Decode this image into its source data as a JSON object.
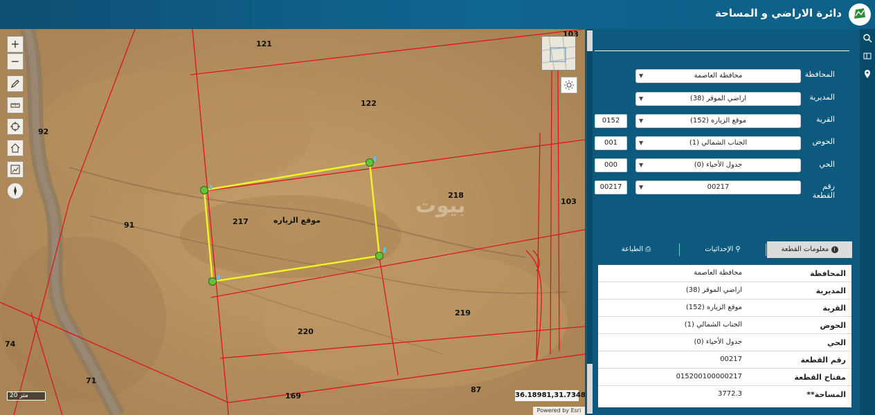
{
  "header": {
    "title": "دائرة الاراضي و المساحة"
  },
  "map": {
    "parcel_labels": [
      {
        "id": "121",
        "text": "121"
      },
      {
        "id": "103a",
        "text": "103"
      },
      {
        "id": "122",
        "text": "122"
      },
      {
        "id": "92",
        "text": "92"
      },
      {
        "id": "218",
        "text": "218"
      },
      {
        "id": "103b",
        "text": "103"
      },
      {
        "id": "217",
        "text": "217"
      },
      {
        "id": "91",
        "text": "91"
      },
      {
        "id": "219",
        "text": "219"
      },
      {
        "id": "220",
        "text": "220"
      },
      {
        "id": "74",
        "text": "74"
      },
      {
        "id": "71",
        "text": "71"
      },
      {
        "id": "87",
        "text": "87"
      },
      {
        "id": "169",
        "text": "169"
      }
    ],
    "site_label": "موقع الزياره",
    "watermark": "بيوت",
    "scale_text": "20 متر",
    "coordinates": "36.18981,31.73488",
    "attribution": "Powered by Esri",
    "zoom_in": "+",
    "zoom_out": "−"
  },
  "form": {
    "fields": [
      {
        "label": "المحافظة",
        "value": "محافظة العاصمة",
        "code": ""
      },
      {
        "label": "المديرية",
        "value": "اراضي الموقر (38)",
        "code": ""
      },
      {
        "label": "القرية",
        "value": "موقع الزياره (152)",
        "code": "0152"
      },
      {
        "label": "الحوض",
        "value": "الجناب الشمالي (1)",
        "code": "001"
      },
      {
        "label": "الحي",
        "value": "جدول الأحياء (0)",
        "code": "000"
      },
      {
        "label": "رقم القطعة",
        "value": "00217",
        "code": "00217"
      }
    ]
  },
  "tabs": {
    "parcel_info": "معلومات القطعة",
    "coordinates": "الإحداثيات",
    "print": "الطباعة"
  },
  "info": {
    "rows": [
      {
        "key": "المحافظة",
        "value": "محافظة العاصمة"
      },
      {
        "key": "المديرية",
        "value": "اراضي الموقر (38)"
      },
      {
        "key": "القرية",
        "value": "موقع الزياره (152)"
      },
      {
        "key": "الحوض",
        "value": "الجناب الشمالي (1)"
      },
      {
        "key": "الحي",
        "value": "جدول الأحياء (0)"
      },
      {
        "key": "رقم القطعة",
        "value": "00217"
      },
      {
        "key": "مفتاح القطعة",
        "value": "015200100000217"
      },
      {
        "key": "المساحة**",
        "value": "3772.3"
      }
    ]
  },
  "colors": {
    "header": "#0e5a7e",
    "parcel_line": "#e0141a",
    "highlight": "#f2f22a",
    "vertex": "#63c23a"
  }
}
